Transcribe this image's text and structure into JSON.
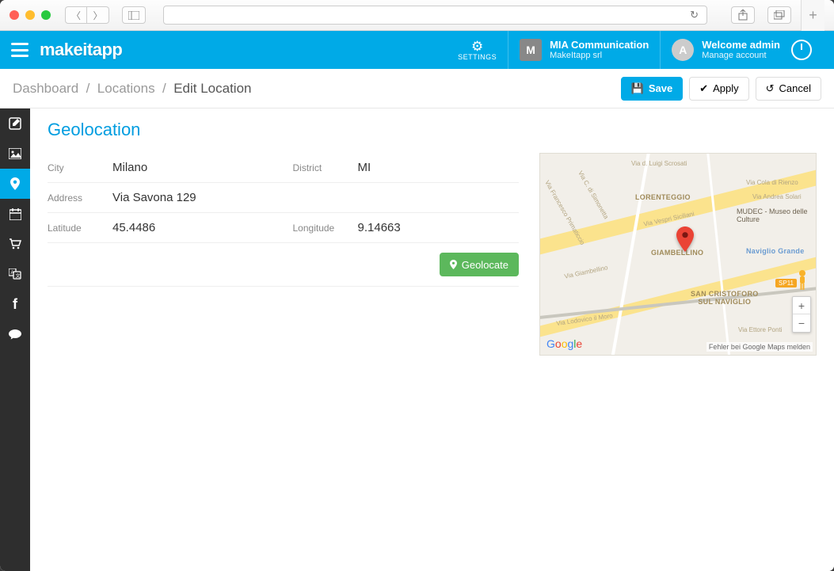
{
  "header": {
    "logo": "makeitapp",
    "settings_label": "SETTINGS",
    "org": {
      "avatar_letter": "M",
      "name": "MIA Communication",
      "sub": "MakeItapp srl"
    },
    "user": {
      "avatar_letter": "A",
      "welcome": "Welcome admin",
      "sub": "Manage account"
    }
  },
  "breadcrumb": {
    "items": [
      "Dashboard",
      "Locations",
      "Edit Location"
    ],
    "save": "Save",
    "apply": "Apply",
    "cancel": "Cancel"
  },
  "sidebar": {
    "items": [
      {
        "name": "edit",
        "active": false
      },
      {
        "name": "image",
        "active": false
      },
      {
        "name": "location",
        "active": true
      },
      {
        "name": "calendar",
        "active": false
      },
      {
        "name": "cart",
        "active": false
      },
      {
        "name": "translate",
        "active": false
      },
      {
        "name": "facebook",
        "active": false
      },
      {
        "name": "chat",
        "active": false
      }
    ]
  },
  "geo": {
    "title": "Geolocation",
    "city_label": "City",
    "city": "Milano",
    "district_label": "District",
    "district": "MI",
    "address_label": "Address",
    "address": "Via Savona 129",
    "lat_label": "Latitude",
    "lat": "45.4486",
    "lon_label": "Longitude",
    "lon": "9.14663",
    "geolocate_btn": "Geolocate"
  },
  "map": {
    "labels": {
      "area1": "LORENTEGGIO",
      "area2": "GIAMBELLINO",
      "area3": "SAN CRISTOFORO\nSUL NAVIGLIO",
      "area4": "Naviglio Grande",
      "poi": "MUDEC - Museo delle Culture",
      "road_tag": "SP11",
      "street1": "Via Lodovico il Moro",
      "street2": "Via Giambellino",
      "street3": "Via Vespri Siciliani",
      "street4": "Via Ettore Ponti",
      "street5": "Via Cola di Rienzo",
      "street6": "Via Andrea Solari",
      "street7": "Via d. Luigi Scrosati",
      "street8": "Via Francesco Primaticcio",
      "street9": "Via C. di Simonetta"
    },
    "attribution": "Fehler bei Google Maps melden"
  }
}
